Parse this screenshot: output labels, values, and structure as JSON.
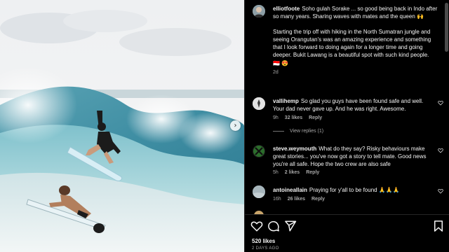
{
  "post": {
    "caption": {
      "username": "elliotfoote",
      "line1": "Soho gulah Sorake ... so good being back in Indo after so many years. Sharing waves with mates and the queen 🙌",
      "line2": "Starting the trip off with hiking in the North Sumatran jungle and seeing Orangutan's was an amazing experience and something that I look forward to doing again for a longer time and going deeper. Bukit Lawang is a beautiful spot with such kind people.",
      "line3": "🇮🇩 😍",
      "time": "2d"
    },
    "comments": [
      {
        "username": "vallihemp",
        "text": "So glad you guys have been found safe and well. Your dad never gave up. And he was right. Awesome.",
        "time": "9h",
        "likes": "32 likes",
        "reply": "Reply",
        "view_replies": "View replies (1)"
      },
      {
        "username": "steve.weymouth",
        "text": "What do they say? Risky behaviours make great stories... you've now got a story to tell mate. Good news you're all safe. Hope the two crew are also safe",
        "time": "5h",
        "likes": "2 likes",
        "reply": "Reply"
      },
      {
        "username": "antoineallain",
        "text": "Praying for y'all to be found 🙏🙏🙏",
        "time": "16h",
        "likes": "26 likes",
        "reply": "Reply"
      }
    ],
    "likes_count": "520 likes",
    "date": "2 DAYS AGO"
  },
  "icons": {
    "like": "heart-icon",
    "comment": "comment-icon",
    "share": "paper-plane-icon",
    "save": "bookmark-icon",
    "next": "chevron-right-icon"
  },
  "colors": {
    "background": "#000000",
    "text": "#f5f5f5",
    "muted": "#a8a8a8",
    "divider": "#262626"
  }
}
